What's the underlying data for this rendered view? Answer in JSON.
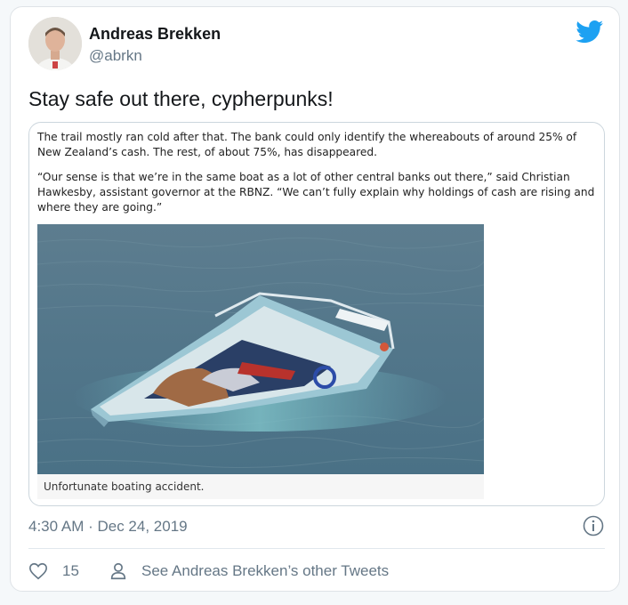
{
  "author": {
    "name": "Andreas Brekken",
    "handle": "@abrkn"
  },
  "tweet": {
    "text": "Stay safe out there, cypherpunks!",
    "timestamp": "4:30 AM · Dec 24, 2019"
  },
  "media": {
    "paragraph_1": "The trail mostly ran cold after that. The bank could only identify the whereabouts of around 25% of New Zealand’s cash. The rest, of about 75%, has disappeared.",
    "paragraph_2": "“Our sense is that we’re in the same boat as a lot of other central banks out there,” said Christian Hawkesby, assistant governor at the RBNZ. “We can’t fully explain why holdings of cash are rising and where they are going.”",
    "caption": "Unfortunate boating accident."
  },
  "actions": {
    "like_count": "15",
    "other_tweets_label": "See Andreas Brekken’s other Tweets"
  },
  "icons": {
    "brand": "twitter-bird-icon",
    "info": "info-icon",
    "like": "heart-icon",
    "profile": "person-icon"
  },
  "colors": {
    "twitter_blue": "#1da1f2",
    "secondary_text": "#657786",
    "border": "#dfe3e7"
  }
}
